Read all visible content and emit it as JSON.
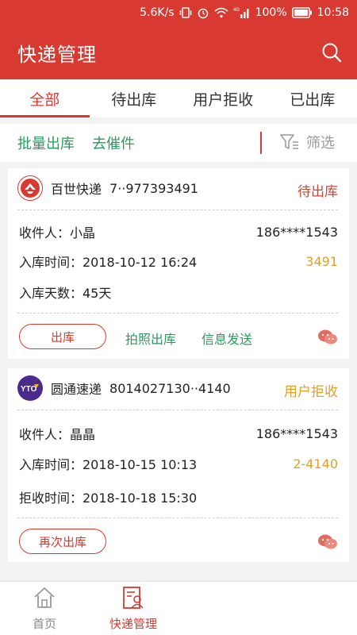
{
  "status_bar": {
    "speed": "5.6K/s",
    "network": "4G",
    "battery": "100%",
    "time": "10:58"
  },
  "app_title": "快递管理",
  "tabs": [
    "全部",
    "待出库",
    "用户拒收",
    "已出库"
  ],
  "actions": {
    "batch_out": "批量出库",
    "urge": "去催件",
    "filter": "筛选"
  },
  "cards": [
    {
      "courier": "百世快递",
      "tracking": "7··977393491",
      "status": "待出库",
      "status_color": "#c2483a",
      "recipient_label": "收件人：小晶",
      "phone": "186****1543",
      "in_time_label": "入库时间：2018-10-12 16:24",
      "code": "3491",
      "days_label": "入库天数：45天",
      "btn": "出库",
      "link1": "拍照出库",
      "link2": "信息发送"
    },
    {
      "courier": "圆通速递",
      "tracking": "8014027130··4140",
      "status": "用户拒收",
      "status_color": "#e0a12a",
      "recipient_label": "收件人：晶晶",
      "phone": "186****1543",
      "in_time_label": "入库时间：2018-10-15 10:13",
      "code": "2-4140",
      "reject_label": "拒收时间：2018-10-18 15:30",
      "btn": "再次出库"
    }
  ],
  "bottom_nav": [
    "首页",
    "快递管理"
  ],
  "colors": {
    "brand": "#d83a32",
    "green": "#2a9a5e",
    "code": "#e0a12a"
  },
  "icons": {
    "search": "search-icon",
    "filter": "filter-icon",
    "home": "home-icon",
    "courier": "courier-manage-icon",
    "wechat": "wechat-icon"
  }
}
